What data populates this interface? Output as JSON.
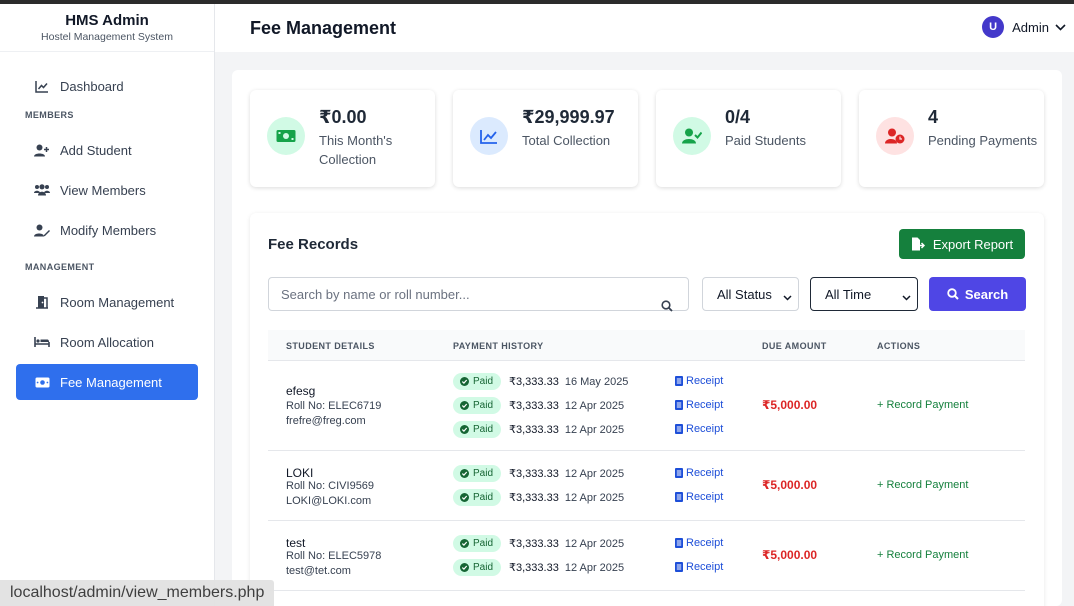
{
  "brand": {
    "title": "HMS Admin",
    "subtitle": "Hostel Management System"
  },
  "sidebar": {
    "dashboard": "Dashboard",
    "section_members": "MEMBERS",
    "add_student": "Add Student",
    "view_members": "View Members",
    "modify_members": "Modify Members",
    "section_management": "MANAGEMENT",
    "room_management": "Room Management",
    "room_allocation": "Room Allocation",
    "fee_management": "Fee Management"
  },
  "header": {
    "title": "Fee Management",
    "user_initial": "U",
    "user_name": "Admin"
  },
  "stats": [
    {
      "value": "₹0.00",
      "label": "This Month's Collection",
      "color": "#16a34a"
    },
    {
      "value": "₹29,999.97",
      "label": "Total Collection",
      "color": "#2563eb"
    },
    {
      "value": "0/4",
      "label": "Paid Students",
      "color": "#16a34a"
    },
    {
      "value": "4",
      "label": "Pending Payments",
      "color": "#dc2626"
    }
  ],
  "records": {
    "title": "Fee Records",
    "export_label": "Export Report",
    "search_placeholder": "Search by name or roll number...",
    "status_filter": "All Status",
    "time_filter": "All Time",
    "search_label": "Search",
    "columns": {
      "student": "STUDENT DETAILS",
      "history": "PAYMENT HISTORY",
      "due": "DUE AMOUNT",
      "actions": "ACTIONS"
    },
    "rows": [
      {
        "name": "efesg",
        "roll": "Roll No: ELEC6719",
        "email": "frefre@freg.com",
        "payments": [
          {
            "status": "Paid",
            "amount": "₹3,333.33",
            "date": "16 May 2025",
            "receipt": "Receipt"
          },
          {
            "status": "Paid",
            "amount": "₹3,333.33",
            "date": "12 Apr 2025",
            "receipt": "Receipt"
          },
          {
            "status": "Paid",
            "amount": "₹3,333.33",
            "date": "12 Apr 2025",
            "receipt": "Receipt"
          }
        ],
        "due": "₹5,000.00",
        "action": "Record Payment"
      },
      {
        "name": "LOKI",
        "roll": "Roll No: CIVI9569",
        "email": "LOKI@LOKI.com",
        "payments": [
          {
            "status": "Paid",
            "amount": "₹3,333.33",
            "date": "12 Apr 2025",
            "receipt": "Receipt"
          },
          {
            "status": "Paid",
            "amount": "₹3,333.33",
            "date": "12 Apr 2025",
            "receipt": "Receipt"
          }
        ],
        "due": "₹5,000.00",
        "action": "Record Payment"
      },
      {
        "name": "test",
        "roll": "Roll No: ELEC5978",
        "email": "test@tet.com",
        "payments": [
          {
            "status": "Paid",
            "amount": "₹3,333.33",
            "date": "12 Apr 2025",
            "receipt": "Receipt"
          },
          {
            "status": "Paid",
            "amount": "₹3,333.33",
            "date": "12 Apr 2025",
            "receipt": "Receipt"
          }
        ],
        "due": "₹5,000.00",
        "action": "Record Payment"
      }
    ]
  },
  "status_url": "localhost/admin/view_members.php"
}
